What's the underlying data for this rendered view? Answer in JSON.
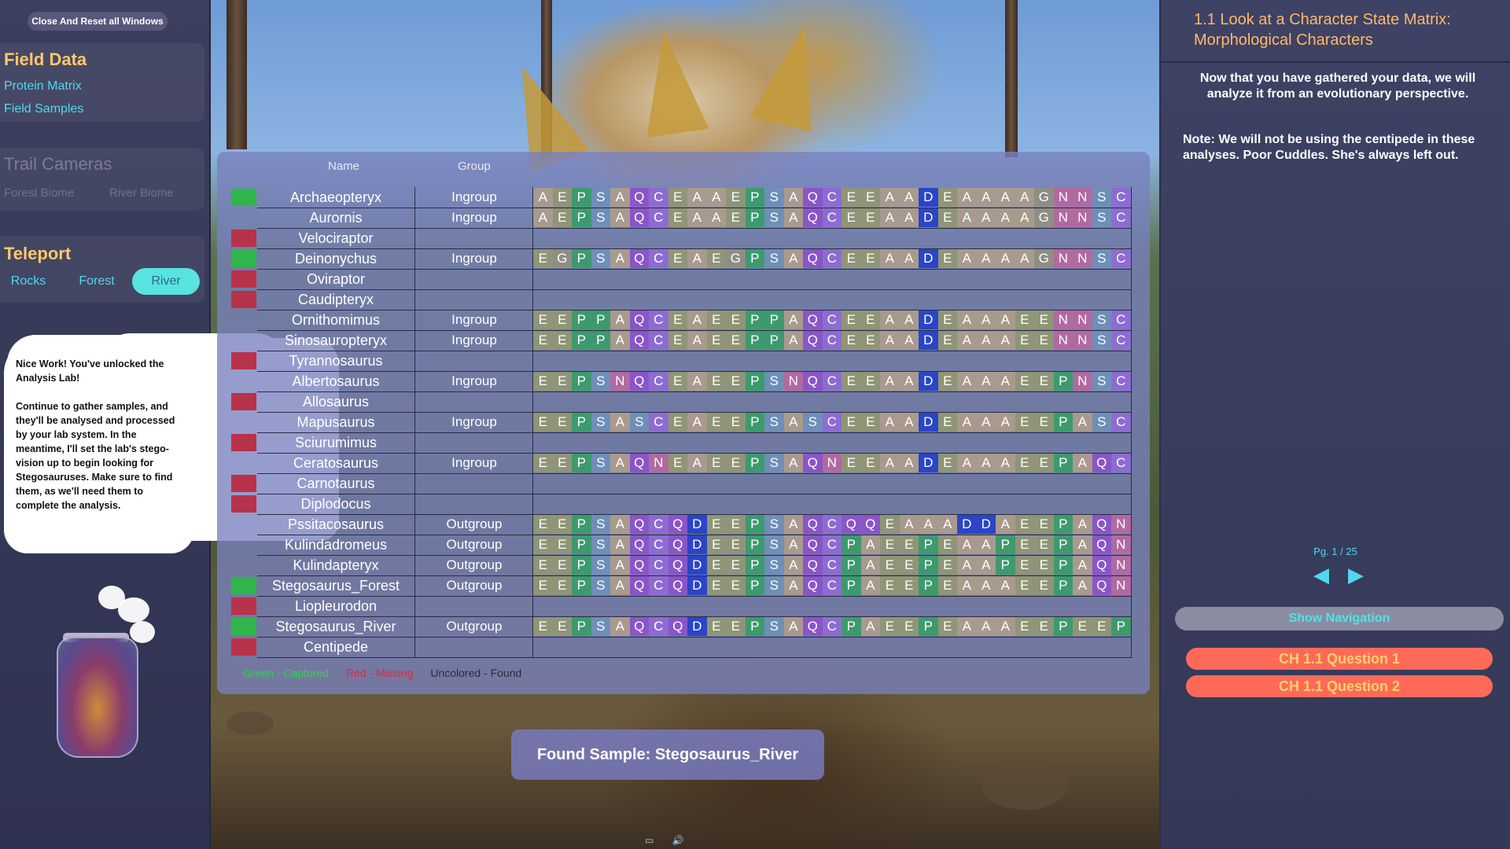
{
  "left": {
    "reset_button": "Close And Reset all Windows",
    "field_data_title": "Field Data",
    "protein_matrix": "Protein Matrix",
    "field_samples": "Field Samples",
    "trail_cameras_title": "Trail Cameras",
    "forest_biome": "Forest Biome",
    "river_biome": "River Biome",
    "teleport_title": "Teleport",
    "teleport": [
      "Rocks",
      "Forest",
      "River"
    ],
    "speech_p1": "Nice Work! You've unlocked the Analysis Lab!",
    "speech_p2": "Continue to gather samples, and they'll be analysed and processed by your lab system. In the meantime, I'll set the lab's stego-vision up to begin looking for Stegosauruses. Make sure to find them, as we'll need them to complete the analysis."
  },
  "matrix": {
    "header_name": "Name",
    "header_group": "Group",
    "rows": [
      {
        "status": "green",
        "name": "Archaeopteryx",
        "group": "Ingroup",
        "seq": "AEPSAQCEAAEPSAQCEEAADEAAAAGNNSC"
      },
      {
        "status": "none",
        "name": "Aurornis",
        "group": "Ingroup",
        "seq": "AEPSAQCEAAEPSAQCEEAADEAAAAGNNSC"
      },
      {
        "status": "red",
        "name": "Velociraptor",
        "group": "",
        "seq": ""
      },
      {
        "status": "green",
        "name": "Deinonychus",
        "group": "Ingroup",
        "seq": "EGPSAQCEAEGPSAQCEEAADEAAAAGNNSC"
      },
      {
        "status": "red",
        "name": "Oviraptor",
        "group": "",
        "seq": ""
      },
      {
        "status": "red",
        "name": "Caudipteryx",
        "group": "",
        "seq": ""
      },
      {
        "status": "none",
        "name": "Ornithomimus",
        "group": "Ingroup",
        "seq": "EEPPAQCEAEEPPAQCEEAADEAAAEENNSC"
      },
      {
        "status": "none",
        "name": "Sinosauropteryx",
        "group": "Ingroup",
        "seq": "EEPPAQCEAEEPPAQCEEAADEAAAEENNSC"
      },
      {
        "status": "red",
        "name": "Tyrannosaurus",
        "group": "",
        "seq": ""
      },
      {
        "status": "none",
        "name": "Albertosaurus",
        "group": "Ingroup",
        "seq": "EEPSNQCEAEEPSNQCEEAADEAAAEEPNSC"
      },
      {
        "status": "red",
        "name": "Allosaurus",
        "group": "",
        "seq": ""
      },
      {
        "status": "none",
        "name": "Mapusaurus",
        "group": "Ingroup",
        "seq": "EEPSASCEAEEPSASCEEAADEAAAEEPASC"
      },
      {
        "status": "red",
        "name": "Sciurumimus",
        "group": "",
        "seq": ""
      },
      {
        "status": "none",
        "name": "Ceratosaurus",
        "group": "Ingroup",
        "seq": "EEPSAQNEAEEPSAQNEEAADEAAAEEPAQC"
      },
      {
        "status": "red",
        "name": "Carnotaurus",
        "group": "",
        "seq": ""
      },
      {
        "status": "red",
        "name": "Diplodocus",
        "group": "",
        "seq": ""
      },
      {
        "status": "none",
        "name": "Pssitacosaurus",
        "group": "Outgroup",
        "seq": "EEPSAQCQDEEPSAQCQQEAAADDAEEPAQN"
      },
      {
        "status": "none",
        "name": "Kulindadromeus",
        "group": "Outgroup",
        "seq": "EEPSAQCQDEEPSAQCPAEEPEAAPEEPAQN"
      },
      {
        "status": "none",
        "name": "Kulindapteryx",
        "group": "Outgroup",
        "seq": "EEPSAQCQDEEPSAQCPAEEPEAAPEEPAQN"
      },
      {
        "status": "green",
        "name": "Stegosaurus_Forest",
        "group": "Outgroup",
        "seq": "EEPSAQCQDEEPSAQCPAEEPEAAAEEPAQN"
      },
      {
        "status": "red",
        "name": "Liopleurodon",
        "group": "",
        "seq": ""
      },
      {
        "status": "green",
        "name": "Stegosaurus_River",
        "group": "Outgroup",
        "seq": "EEPSAQCQDEEPSAQCPAEEPEAAAEEPEEP"
      },
      {
        "status": "red",
        "name": "Centipede",
        "group": "",
        "seq": ""
      }
    ],
    "legend_green": "Green - Captured",
    "legend_red": "Red - Missing",
    "legend_found": "Uncolored - Found"
  },
  "amino_colors": {
    "A": "#a99a8e",
    "E": "#8f9576",
    "P": "#3d9a6e",
    "S": "#6f8fb8",
    "Q": "#8a55c9",
    "C": "#8d6cd2",
    "D": "#2a45c8",
    "G": "#8e8e84",
    "N": "#b06aa0"
  },
  "legend_colors": {
    "green": "#2fd34a",
    "red": "#e0263a",
    "found": "#2a2c44"
  },
  "found_banner": "Found Sample: Stegosaurus_River",
  "right": {
    "title": "1.1 Look at a Character State Matrix: Morphological Characters",
    "intro": "Now that you have gathered your data, we will analyze it from an evolutionary perspective.",
    "note": "Note: We will not be using the centipede in these analyses. Poor Cuddles. She's always left out.",
    "page_indicator": "Pg. 1 / 25",
    "prev_glyph": "◀",
    "next_glyph": "▶",
    "show_navigation": "Show Navigation",
    "question1": "CH 1.1 Question 1",
    "question2": "CH 1.1 Question 2"
  },
  "icons": {
    "window": "▭",
    "audio": "🔊"
  }
}
